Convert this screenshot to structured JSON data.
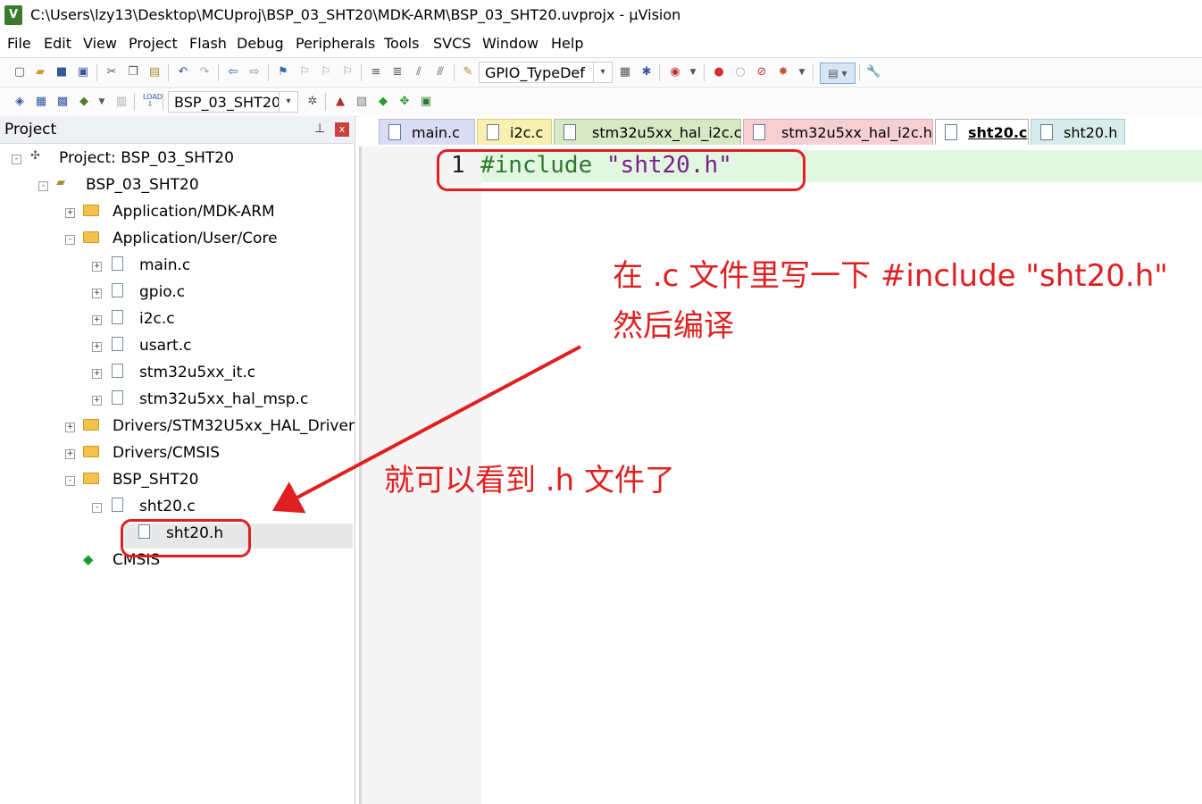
{
  "window": {
    "title": "C:\\Users\\lzy13\\Desktop\\MCUproj\\BSP_03_SHT20\\MDK-ARM\\BSP_03_SHT20.uvprojx - µVision",
    "logo_letter": "V"
  },
  "menu": {
    "items": [
      "File",
      "Edit",
      "View",
      "Project",
      "Flash",
      "Debug",
      "Peripherals",
      "Tools",
      "SVCS",
      "Window",
      "Help"
    ]
  },
  "toolbar1": {
    "combo_value": "GPIO_TypeDef",
    "combo_arrow": "▾"
  },
  "toolbar2": {
    "target_value": "BSP_03_SHT20",
    "combo_arrow": "▾"
  },
  "project_panel": {
    "title": "Project",
    "pin_glyph": "📌",
    "close_glyph": "x",
    "tree": [
      {
        "label": "Project: BSP_03_SHT20",
        "expander": "-"
      },
      {
        "label": "BSP_03_SHT20",
        "expander": "-"
      },
      {
        "label": "Application/MDK-ARM",
        "expander": "+"
      },
      {
        "label": "Application/User/Core",
        "expander": "-"
      },
      {
        "label": "main.c",
        "expander": "+"
      },
      {
        "label": "gpio.c",
        "expander": "+"
      },
      {
        "label": "i2c.c",
        "expander": "+"
      },
      {
        "label": "usart.c",
        "expander": "+"
      },
      {
        "label": "stm32u5xx_it.c",
        "expander": "+"
      },
      {
        "label": "stm32u5xx_hal_msp.c",
        "expander": "+"
      },
      {
        "label": "Drivers/STM32U5xx_HAL_Driver",
        "expander": "+"
      },
      {
        "label": "Drivers/CMSIS",
        "expander": "+"
      },
      {
        "label": "BSP_SHT20",
        "expander": "-"
      },
      {
        "label": "sht20.c",
        "expander": "-"
      },
      {
        "label": "sht20.h",
        "expander": ""
      },
      {
        "label": "CMSIS",
        "expander": ""
      }
    ]
  },
  "tabs": [
    {
      "label": "main.c",
      "color": "#d9dcf2"
    },
    {
      "label": "i2c.c",
      "color": "#f7f0b0"
    },
    {
      "label": "stm32u5xx_hal_i2c.c",
      "color": "#d6e8c4"
    },
    {
      "label": "stm32u5xx_hal_i2c.h",
      "color": "#f6cfd2"
    },
    {
      "label": "sht20.c",
      "color": "#ffffff",
      "active": true
    },
    {
      "label": "sht20.h",
      "color": "#d9ecec"
    }
  ],
  "editor": {
    "line_number": "1",
    "code_directive": "#include",
    "code_string": "\"sht20.h\""
  },
  "annotations": {
    "note1_line1": "在 .c 文件里写一下 #include \"sht20.h\"",
    "note1_line2": "然后编译",
    "note2": "就可以看到 .h 文件了",
    "color": "#e02020"
  }
}
